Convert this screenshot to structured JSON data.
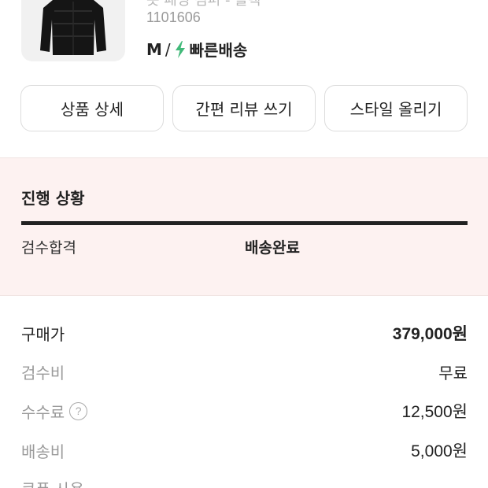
{
  "product": {
    "name": "숏 패딩 점퍼 - 블랙",
    "code": "1101606",
    "size": "M",
    "separator": "/",
    "delivery_label": "빠른배송",
    "image_icon": "jacket-image",
    "bolt_color": "#41b979"
  },
  "actions": {
    "detail": "상품 상세",
    "review": "간편 리뷰 쓰기",
    "style": "스타일 올리기"
  },
  "progress": {
    "title": "진행 상황",
    "steps": [
      "검수합격",
      "배송완료"
    ],
    "current_step": "배송완료",
    "completion": 1.0,
    "background": "#fdf2f1"
  },
  "prices": {
    "purchase_label": "구매가",
    "purchase_value": "379,000원",
    "inspection_label": "검수비",
    "inspection_value": "무료",
    "fee_label": "수수료",
    "fee_help": "?",
    "fee_value": "12,500원",
    "shipping_label": "배송비",
    "shipping_value": "5,000원",
    "coupon_label": "쿠폰 사용"
  }
}
